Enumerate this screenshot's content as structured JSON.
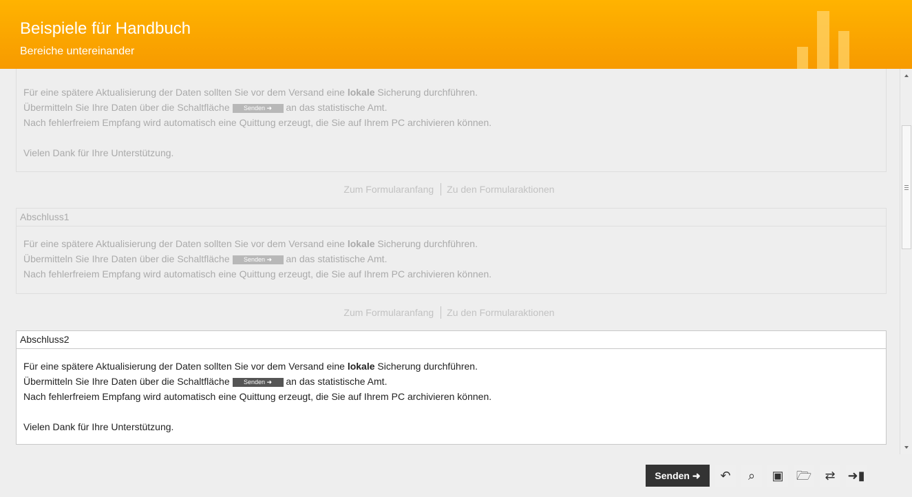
{
  "header": {
    "title": "Beispiele für Handbuch",
    "subtitle": "Bereiche untereinander"
  },
  "sections": [
    {
      "heading": "",
      "line1_before": "Für eine spätere Aktualisierung der Daten sollten Sie vor dem Versand eine ",
      "line1_bold": "lokale",
      "line1_after": " Sicherung durchführen.",
      "line2_before": "Übermitteln Sie Ihre Daten über die Schaltfläche ",
      "send_label": "Senden ➜",
      "line2_after": " an das statistische Amt.",
      "line3": "Nach fehlerfreiem Empfang wird automatisch eine Quittung erzeugt, die Sie auf Ihrem PC archivieren können.",
      "thanks": "Vielen Dank für Ihre Unterstützung."
    },
    {
      "heading": "Abschluss1",
      "line1_before": "Für eine spätere Aktualisierung der Daten sollten Sie vor dem Versand eine ",
      "line1_bold": "lokale",
      "line1_after": " Sicherung durchführen.",
      "line2_before": "Übermitteln Sie Ihre Daten über die Schaltfläche ",
      "send_label": "Senden ➜",
      "line2_after": " an das statistische Amt.",
      "line3": "Nach fehlerfreiem Empfang wird automatisch eine Quittung erzeugt, die Sie auf Ihrem PC archivieren können."
    },
    {
      "heading": "Abschluss2",
      "line1_before": "Für eine spätere Aktualisierung der Daten sollten Sie vor dem Versand eine ",
      "line1_bold": "lokale",
      "line1_after": " Sicherung durchführen.",
      "line2_before": "Übermitteln Sie Ihre Daten über die Schaltfläche ",
      "send_label": "Senden ➜",
      "line2_after": " an das statistische Amt.",
      "line3": "Nach fehlerfreiem Empfang wird automatisch eine Quittung erzeugt, die Sie auf Ihrem PC archivieren können.",
      "thanks": "Vielen Dank für Ihre Unterstützung."
    }
  ],
  "nav": {
    "to_start": "Zum Formularanfang",
    "to_actions": "Zu den Formularaktionen"
  },
  "toolbar": {
    "send": "Senden ➜",
    "icons": {
      "undo": "↶",
      "search": "⌕",
      "save": "▣",
      "open": "🗁",
      "transfer": "⇄",
      "exit": "➜▮"
    }
  }
}
